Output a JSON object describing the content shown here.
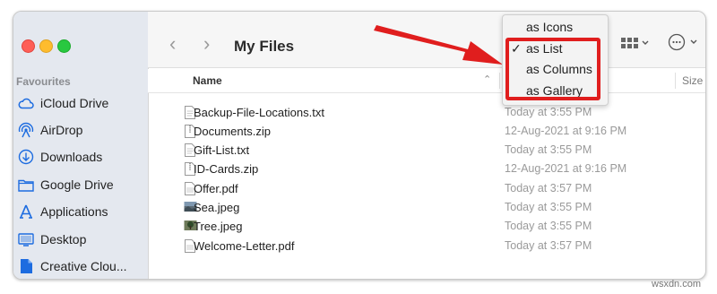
{
  "window": {
    "title": "My Files",
    "colors": {
      "close": "#fe5f57",
      "minimize": "#febc2e",
      "zoom": "#28c840",
      "sidebar_icon": "#1d6ce0",
      "highlight": "#e01e1e"
    }
  },
  "sidebar": {
    "heading": "Favourites",
    "items": [
      {
        "label": "iCloud Drive",
        "icon": "cloud-icon"
      },
      {
        "label": "AirDrop",
        "icon": "airdrop-icon"
      },
      {
        "label": "Downloads",
        "icon": "download-icon"
      },
      {
        "label": "Google Drive",
        "icon": "folder-icon"
      },
      {
        "label": "Applications",
        "icon": "applications-icon"
      },
      {
        "label": "Desktop",
        "icon": "desktop-icon"
      },
      {
        "label": "Creative Clou...",
        "icon": "document-icon"
      }
    ]
  },
  "toolbar": {
    "back_icon": "chevron-left-icon",
    "forward_icon": "chevron-right-icon",
    "view_icon": "grid-view-icon",
    "more_icon": "ellipsis-circle-icon"
  },
  "columns": {
    "name": "Name",
    "size": "Size"
  },
  "files": [
    {
      "name": "Backup-File-Locations.txt",
      "date": "Today at 3:55 PM",
      "icon": "text-file-icon"
    },
    {
      "name": "Documents.zip",
      "date": "12-Aug-2021 at 9:16 PM",
      "icon": "zip-file-icon"
    },
    {
      "name": "Gift-List.txt",
      "date": "Today at 3:55 PM",
      "icon": "text-file-icon"
    },
    {
      "name": "ID-Cards.zip",
      "date": "12-Aug-2021 at 9:16 PM",
      "icon": "zip-file-icon"
    },
    {
      "name": "Offer.pdf",
      "date": "Today at 3:57 PM",
      "icon": "pdf-file-icon"
    },
    {
      "name": "Sea.jpeg",
      "date": "Today at 3:55 PM",
      "icon": "image-file-icon"
    },
    {
      "name": "Tree.jpeg",
      "date": "Today at 3:55 PM",
      "icon": "image-file-icon"
    },
    {
      "name": "Welcome-Letter.pdf",
      "date": "Today at 3:57 PM",
      "icon": "pdf-file-icon"
    }
  ],
  "view_menu": {
    "items": [
      {
        "label": "as Icons",
        "checked": false
      },
      {
        "label": "as List",
        "checked": true
      },
      {
        "label": "as Columns",
        "checked": false
      },
      {
        "label": "as Gallery",
        "checked": false
      }
    ],
    "check_mark": "✓"
  },
  "watermark": "wsxdn.com"
}
